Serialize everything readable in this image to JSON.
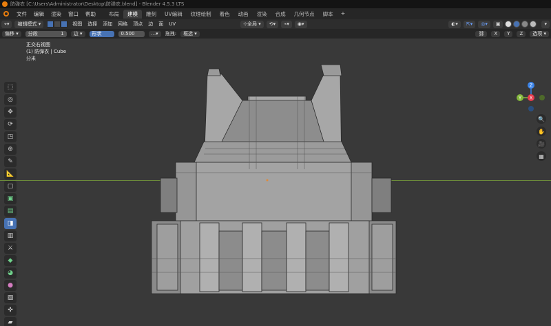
{
  "titlebar": {
    "text": "防弹衣 [C:\\Users\\Administrator\\Desktop\\防弹衣.blend] - Blender 4.5.3 LTS"
  },
  "menu": [
    "文件",
    "编辑",
    "渲染",
    "窗口",
    "帮助"
  ],
  "workspaces": [
    "布局",
    "建模",
    "雕刻",
    "UV编辑",
    "纹理绘制",
    "着色",
    "动画",
    "渲染",
    "合成",
    "几何节点",
    "脚本"
  ],
  "active_workspace": "建模",
  "header": {
    "mode": "编辑模式",
    "menus": [
      "视图",
      "选择",
      "添加",
      "网格",
      "顶点",
      "边",
      "面",
      "UV"
    ],
    "transform_orientation": "全局",
    "options": "选项",
    "axes": [
      "X",
      "Y",
      "Z"
    ]
  },
  "toolsettings": {
    "offset_label": "偏移",
    "segments_label": "分段",
    "segments_value": "1",
    "affect": "边",
    "shape_label": "形状",
    "shape_value": "0.500",
    "drag_label": "拖拽:",
    "drag_value": "框选"
  },
  "viewport_info": {
    "view": "正交右视图",
    "object": "(1) 防弹衣 | Cube",
    "units": "分米"
  },
  "tools": [
    "select-box",
    "cursor",
    "move",
    "rotate",
    "scale",
    "transform",
    "annotate",
    "measure",
    "add-cube",
    "extrude",
    "inset",
    "bevel",
    "loop-cut",
    "knife",
    "poly-build",
    "spin",
    "smooth",
    "edge-slide",
    "shrink-fatten",
    "shear",
    "rip"
  ],
  "active_tool": "bevel",
  "gizmo": {
    "x": "X",
    "y": "Y",
    "z": "Z"
  },
  "colors": {
    "accent": "#4772b3",
    "x_axis": "#e8394b",
    "y_axis": "#83b73a",
    "z_axis": "#3a83e8",
    "viewport": "#393939",
    "horizon": "#6c8c3a"
  }
}
